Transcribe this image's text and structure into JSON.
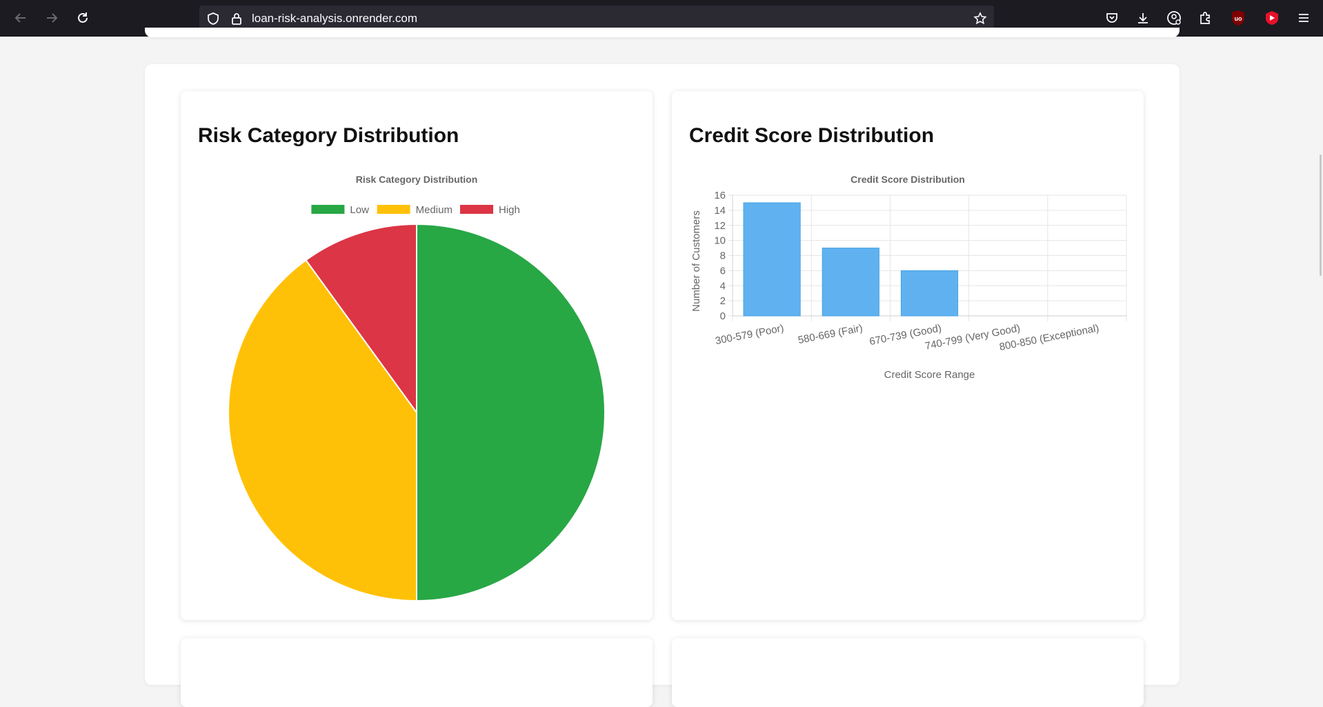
{
  "browser": {
    "url": "loan-risk-analysis.onrender.com"
  },
  "cards": {
    "risk": {
      "heading": "Risk Category Distribution"
    },
    "credit": {
      "heading": "Credit Score Distribution"
    }
  },
  "chart_data": [
    {
      "type": "pie",
      "title": "Risk Category Distribution",
      "labels": [
        "Low",
        "Medium",
        "High"
      ],
      "values": [
        15,
        12,
        3
      ],
      "colors": [
        "#28a745",
        "#ffc107",
        "#dc3545"
      ],
      "legend": "top"
    },
    {
      "type": "bar",
      "title": "Credit Score Distribution",
      "categories": [
        "300-579 (Poor)",
        "580-669 (Fair)",
        "670-739 (Good)",
        "740-799 (Very Good)",
        "800-850 (Exceptional)"
      ],
      "values": [
        15,
        9,
        6,
        0,
        0
      ],
      "xlabel": "Credit Score Range",
      "ylabel": "Number of Customers",
      "ylim": [
        0,
        16
      ],
      "yticks": [
        0,
        2,
        4,
        6,
        8,
        10,
        12,
        14,
        16
      ],
      "color": "#5fb2ef",
      "grid": true
    }
  ]
}
